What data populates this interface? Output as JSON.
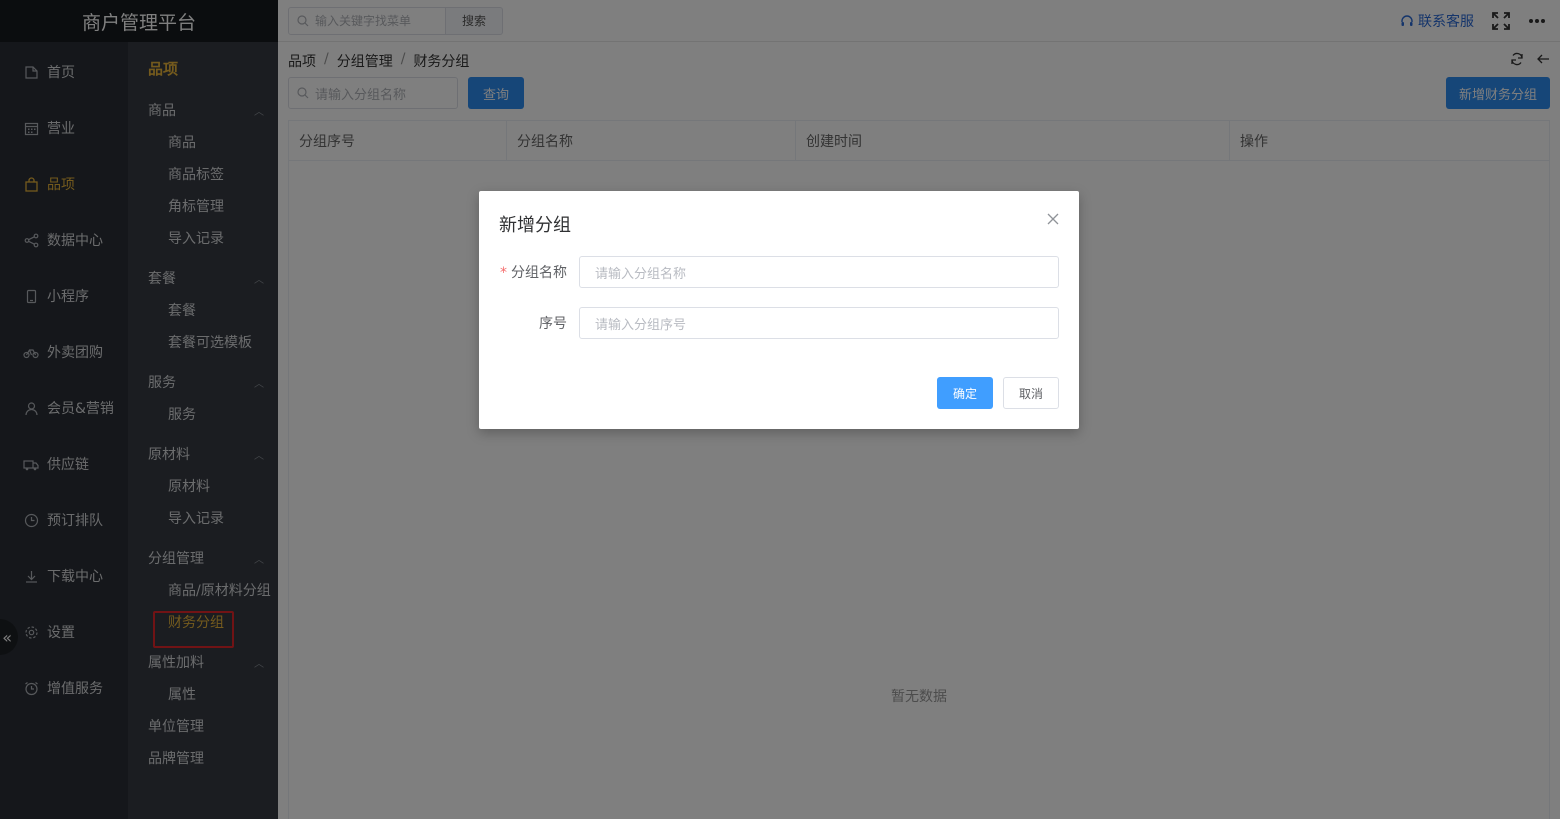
{
  "app": {
    "title": "商户管理平台"
  },
  "topbar": {
    "search_placeholder": "输入关键字找菜单",
    "search_button": "搜索",
    "contact": "联系客服",
    "fullscreen_icon": "fullscreen-icon",
    "more_icon": "more-icon"
  },
  "leftnav": {
    "items": [
      {
        "label": "首页",
        "icon": "home-icon"
      },
      {
        "label": "营业",
        "icon": "calendar-icon"
      },
      {
        "label": "品项",
        "icon": "bag-icon",
        "active": true
      },
      {
        "label": "数据中心",
        "icon": "share-icon"
      },
      {
        "label": "小程序",
        "icon": "phone-icon"
      },
      {
        "label": "外卖团购",
        "icon": "bike-icon"
      },
      {
        "label": "会员&营销",
        "icon": "user-icon"
      },
      {
        "label": "供应链",
        "icon": "truck-icon"
      },
      {
        "label": "预订排队",
        "icon": "clock-icon"
      },
      {
        "label": "下载中心",
        "icon": "download-icon"
      },
      {
        "label": "设置",
        "icon": "gear-icon"
      },
      {
        "label": "增值服务",
        "icon": "alarm-icon"
      }
    ],
    "collapse_glyph": "«"
  },
  "subnav": {
    "title": "品项",
    "groups": [
      {
        "label": "商品",
        "items": [
          "商品",
          "商品标签",
          "角标管理",
          "导入记录"
        ]
      },
      {
        "label": "套餐",
        "items": [
          "套餐",
          "套餐可选模板"
        ]
      },
      {
        "label": "服务",
        "items": [
          "服务"
        ]
      },
      {
        "label": "原材料",
        "items": [
          "原材料",
          "导入记录"
        ]
      },
      {
        "label": "分组管理",
        "items": [
          "商品/原材料分组",
          "财务分组"
        ]
      },
      {
        "label": "属性加料",
        "items": [
          "属性"
        ]
      }
    ],
    "singles": [
      "单位管理",
      "品牌管理"
    ],
    "active_item": "财务分组"
  },
  "breadcrumb": [
    "品项",
    "分组管理",
    "财务分组"
  ],
  "breadcrumb_sep": "/",
  "toolbar": {
    "query_placeholder": "请输入分组名称",
    "query_button": "查询",
    "add_button": "新增财务分组"
  },
  "table": {
    "columns": [
      "分组序号",
      "分组名称",
      "创建时间",
      "操作"
    ],
    "empty_text": "暂无数据"
  },
  "modal": {
    "title": "新增分组",
    "fields": [
      {
        "label": "分组名称",
        "required": true,
        "placeholder": "请输入分组名称"
      },
      {
        "label": "序号",
        "required": false,
        "placeholder": "请输入分组序号"
      }
    ],
    "ok": "确定",
    "cancel": "取消"
  },
  "colors": {
    "accent": "#e8b53a",
    "primary": "#2d8cf0",
    "highlight": "#e3262b"
  }
}
